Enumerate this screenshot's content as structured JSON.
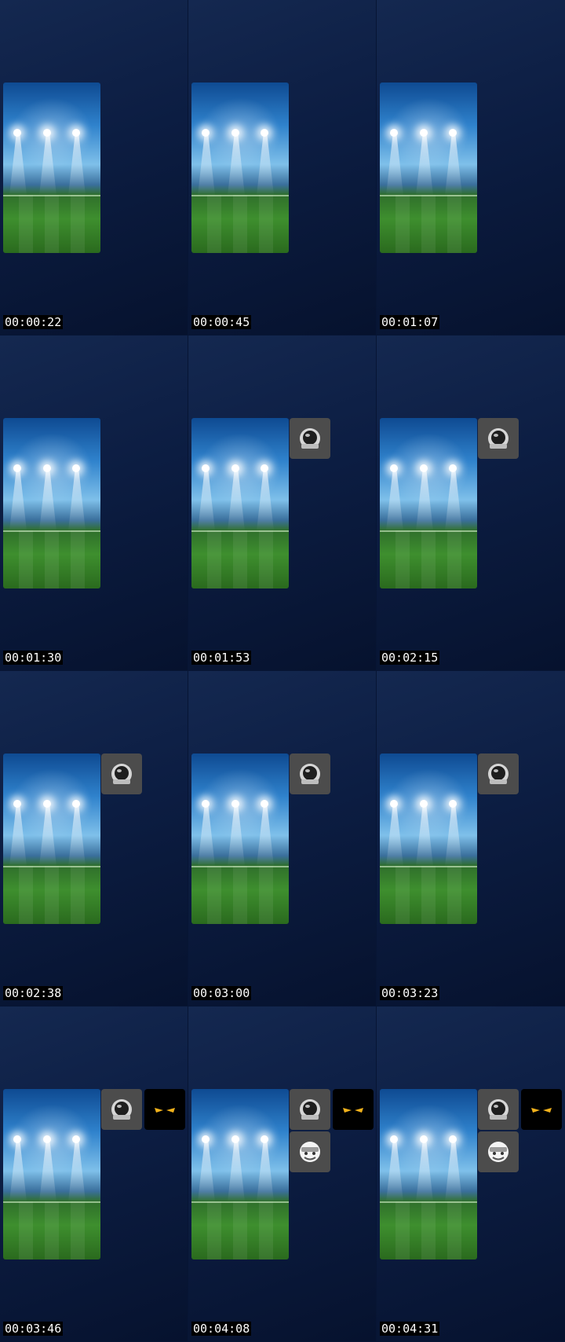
{
  "frames": [
    {
      "timestamp": "00:00:22",
      "participants": []
    },
    {
      "timestamp": "00:00:45",
      "participants": []
    },
    {
      "timestamp": "00:01:07",
      "participants": []
    },
    {
      "timestamp": "00:01:30",
      "participants": []
    },
    {
      "timestamp": "00:01:53",
      "participants": [
        "astronaut-avatar"
      ]
    },
    {
      "timestamp": "00:02:15",
      "participants": [
        "astronaut-avatar"
      ]
    },
    {
      "timestamp": "00:02:38",
      "participants": [
        "astronaut-avatar"
      ]
    },
    {
      "timestamp": "00:03:00",
      "participants": [
        "astronaut-avatar"
      ]
    },
    {
      "timestamp": "00:03:23",
      "participants": [
        "astronaut-avatar"
      ]
    },
    {
      "timestamp": "00:03:46",
      "participants": [
        "astronaut-avatar",
        "glowing-eyes-avatar"
      ]
    },
    {
      "timestamp": "00:04:08",
      "participants": [
        "astronaut-avatar",
        "glowing-eyes-avatar",
        "cartoon-face-avatar"
      ]
    },
    {
      "timestamp": "00:04:31",
      "participants": [
        "astronaut-avatar",
        "glowing-eyes-avatar",
        "cartoon-face-avatar"
      ]
    }
  ],
  "colors": {
    "background": "#0a1a3c",
    "avatar_tile": "#4c4c4c",
    "eyes_tile": "#000000",
    "eyes_glow": "#f2b21c"
  }
}
